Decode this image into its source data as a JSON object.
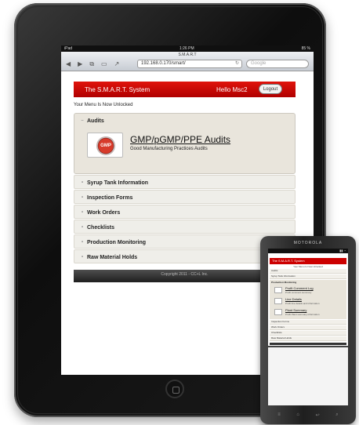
{
  "statusbar": {
    "device": "iPad",
    "time": "1:26 PM",
    "battery": "85 %"
  },
  "browser": {
    "page_title": "S.M.A.R.T",
    "url": "192.168.0.170/smart/",
    "search_placeholder": "Google",
    "icons": [
      "back-icon",
      "forward-icon",
      "tabs-icon",
      "bookmarks-icon",
      "share-icon",
      "reload-icon"
    ]
  },
  "app": {
    "title": "The S.M.A.R.T. System",
    "greeting": "Hello Msc2",
    "logout_label": "Logout",
    "unlock_message": "Your Menu Is Now Unlocked",
    "footer": "Copyright 2011 - CC+L Inc.",
    "accent_color": "#cc0000"
  },
  "menu": {
    "audits": {
      "label": "Audits",
      "item": {
        "logo_text": "GMP",
        "title": "GMP/pGMP/PPE Audits",
        "subtitle": "Good Manufacturing Practices Audits"
      }
    },
    "sections": [
      "Syrup Tank Information",
      "Inspection Forms",
      "Work Orders",
      "Checklists",
      "Production Monitoring",
      "Raw Material Holds"
    ]
  },
  "phone": {
    "brand": "MOTOROLA",
    "app_title": "The S.M.A.R.T. System",
    "rows": [
      "Audits",
      "Syrup Tank Information"
    ],
    "production_header": "Production Monitoring",
    "items": [
      {
        "title": "Profit Comment Log",
        "sub": "Profit comment summary"
      },
      {
        "title": "Line Details",
        "sub": "Profit line details and information"
      },
      {
        "title": "Plant Summary",
        "sub": "Profit Plant summary information"
      }
    ],
    "rows_after": [
      "Inspection Forms",
      "Work Orders",
      "Checklists",
      "Raw Material Holds"
    ]
  }
}
